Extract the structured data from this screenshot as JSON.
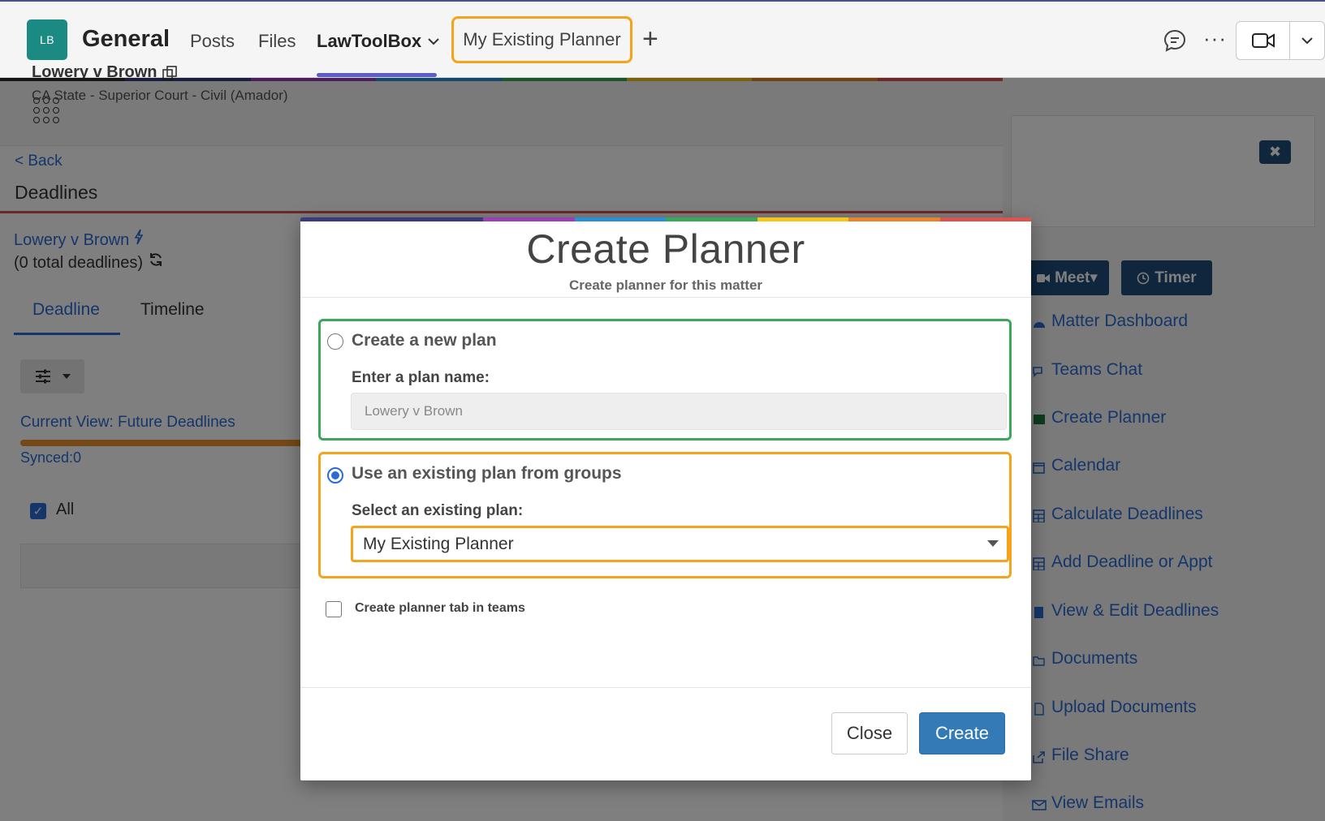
{
  "header": {
    "team_initials": "LB",
    "channel_name": "General",
    "tabs": {
      "posts": "Posts",
      "files": "Files",
      "lawtoolbox": "LawToolBox",
      "planner": "My Existing Planner",
      "add": "+"
    },
    "more": "···"
  },
  "main": {
    "back": "< Back",
    "title": "Deadlines",
    "matter_name": "Lowery v Brown",
    "total_deadlines": "(0 total deadlines)",
    "tabs": {
      "deadline": "Deadline",
      "timeline": "Timeline"
    },
    "current_view": "Current View: Future Deadlines",
    "synced": "Synced:0",
    "all_label": "All"
  },
  "right_panel": {
    "matter_title": "Lowery v Brown",
    "matter_court": "CA State - Superior Court - Civil (Amador)",
    "close_label": "✖",
    "meet_label": "Meet▾",
    "timer_label": "Timer",
    "links": [
      "Matter Dashboard",
      "Teams Chat",
      "Create Planner",
      "Calendar",
      "Calculate Deadlines",
      "Add Deadline or Appt",
      "View & Edit Deadlines",
      "Documents",
      "Upload Documents",
      "File Share",
      "View Emails"
    ]
  },
  "modal": {
    "title": "Create Planner",
    "subtitle": "Create planner for this matter",
    "new_plan": {
      "label": "Create a new plan",
      "field_label": "Enter a plan name:",
      "value": "Lowery v Brown",
      "selected": false
    },
    "existing_plan": {
      "label": "Use an existing plan from groups",
      "field_label": "Select an existing plan:",
      "selected_value": "My Existing Planner",
      "selected": true
    },
    "planner_tab_checkbox": {
      "label": "Create planner tab in teams",
      "checked": false
    },
    "buttons": {
      "close": "Close",
      "create": "Create"
    }
  },
  "colors": {
    "accent_blue": "#2b6cd4",
    "primary_button": "#337ab7",
    "highlight_orange": "#f5a31a",
    "highlight_green": "#3aa85a",
    "team_avatar": "#1a8a83",
    "dark_navy": "#1f4d7a"
  }
}
